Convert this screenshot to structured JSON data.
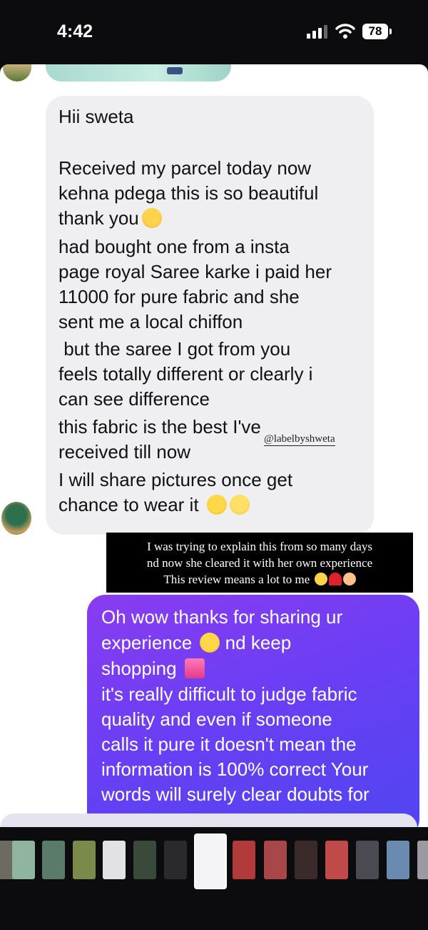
{
  "status_bar": {
    "time": "4:42",
    "battery": "78"
  },
  "incoming_message": {
    "lines": [
      "Hii sweta",
      "",
      "Received my parcel today now",
      "kehna pdega this is so beautiful",
      "thank you",
      "had bought one from a insta",
      "page royal Saree karke i paid her",
      "11000 for pure fabric and she",
      "sent me a local chiffon",
      " but the saree I got from you",
      "feels totally different or clearly i",
      "can see difference",
      "this fabric is the best I've",
      "received till now",
      "I will share pictures once get",
      "chance to wear it"
    ],
    "watermark": "@labelbyshweta"
  },
  "caption": {
    "lines": [
      "I was trying to explain this from so many days",
      "nd now she cleared it with her own experience",
      "This review means a lot to me"
    ]
  },
  "outgoing_message": {
    "lines": [
      "Oh wow thanks for sharing ur",
      "experience",
      "nd keep",
      "shopping",
      "it's really difficult to judge fabric",
      "quality and even if someone",
      "calls it pure it doesn't mean the",
      "information is 100% correct Your",
      "words will surely clear doubts for"
    ]
  },
  "colors": {
    "incoming_bubble": "#efeff1",
    "outgoing_gradient_start": "#8a3cf0",
    "outgoing_gradient_end": "#4f46f0",
    "caption_bg": "#000000"
  }
}
